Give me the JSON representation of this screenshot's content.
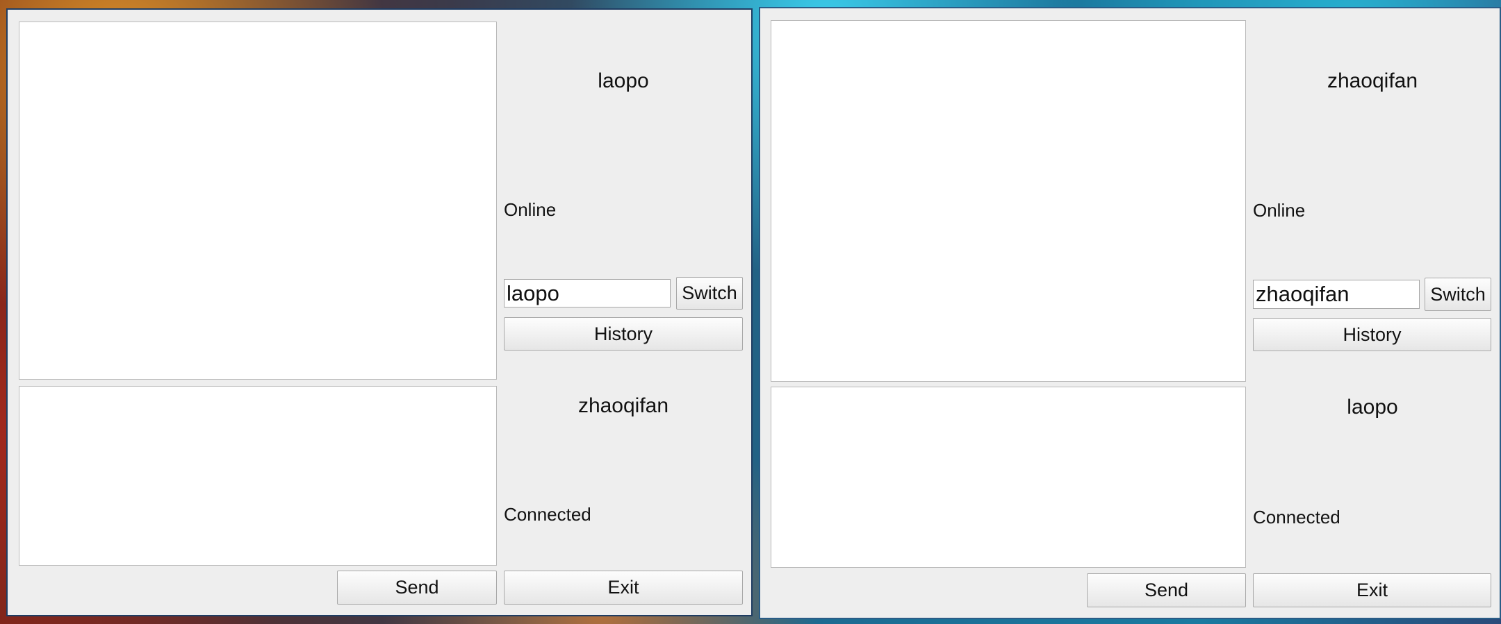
{
  "windows": [
    {
      "name": "left",
      "user_name": "laopo",
      "user_status": "Online",
      "target_input_value": "laopo",
      "switch_label": "Switch",
      "history_label": "History",
      "peer_name": "zhaoqifan",
      "peer_status": "Connected",
      "send_label": "Send",
      "exit_label": "Exit"
    },
    {
      "name": "right",
      "user_name": "zhaoqifan",
      "user_status": "Online",
      "target_input_value": "zhaoqifan",
      "switch_label": "Switch",
      "history_label": "History",
      "peer_name": "laopo",
      "peer_status": "Connected",
      "send_label": "Send",
      "exit_label": "Exit"
    }
  ]
}
